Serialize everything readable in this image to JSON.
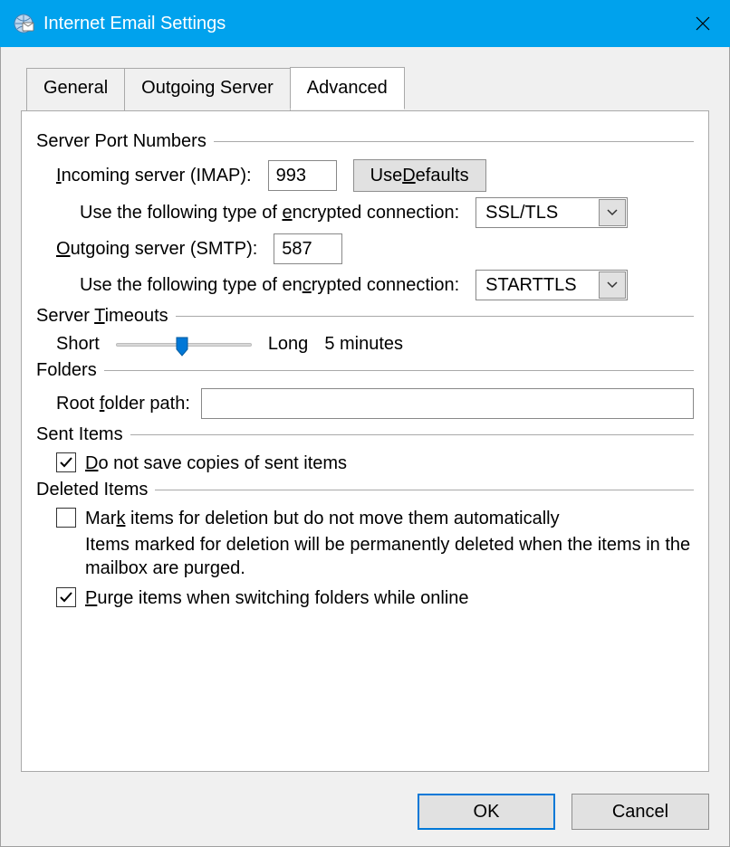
{
  "titlebar": {
    "title": "Internet Email Settings"
  },
  "tabs": {
    "general": "General",
    "outgoing": "Outgoing Server",
    "advanced": "Advanced"
  },
  "groups": {
    "ports": "Server Port Numbers",
    "timeouts_pre": "Server ",
    "timeouts_u": "T",
    "timeouts_post": "imeouts",
    "folders": "Folders",
    "sent": "Sent Items",
    "deleted": "Deleted Items"
  },
  "ports": {
    "incoming_pre": "",
    "incoming_u": "I",
    "incoming_post": "ncoming server (IMAP):",
    "incoming_value": "993",
    "use_defaults_pre": "Use ",
    "use_defaults_u": "D",
    "use_defaults_post": "efaults",
    "enc_in_pre": "Use the following type of ",
    "enc_in_u": "e",
    "enc_in_post": "ncrypted connection:",
    "enc_in_value": "SSL/TLS",
    "outgoing_pre": "",
    "outgoing_u": "O",
    "outgoing_post": "utgoing server (SMTP):",
    "outgoing_value": "587",
    "enc_out_pre": "Use the following type of en",
    "enc_out_u": "c",
    "enc_out_post": "rypted connection:",
    "enc_out_value": "STARTTLS"
  },
  "timeouts": {
    "short": "Short",
    "long": "Long",
    "value": "5 minutes"
  },
  "folders": {
    "root_pre": "Root ",
    "root_u": "f",
    "root_post": "older path:",
    "root_value": ""
  },
  "sent": {
    "dont_save_pre": "",
    "dont_save_u": "D",
    "dont_save_post": "o not save copies of sent items"
  },
  "deleted": {
    "mark_pre": "Mar",
    "mark_u": "k",
    "mark_post": " items for deletion but do not move them automatically",
    "note": "Items marked for deletion will be permanently deleted when the items in the mailbox are purged.",
    "purge_pre": "",
    "purge_u": "P",
    "purge_post": "urge items when switching folders while online"
  },
  "footer": {
    "ok": "OK",
    "cancel": "Cancel"
  }
}
